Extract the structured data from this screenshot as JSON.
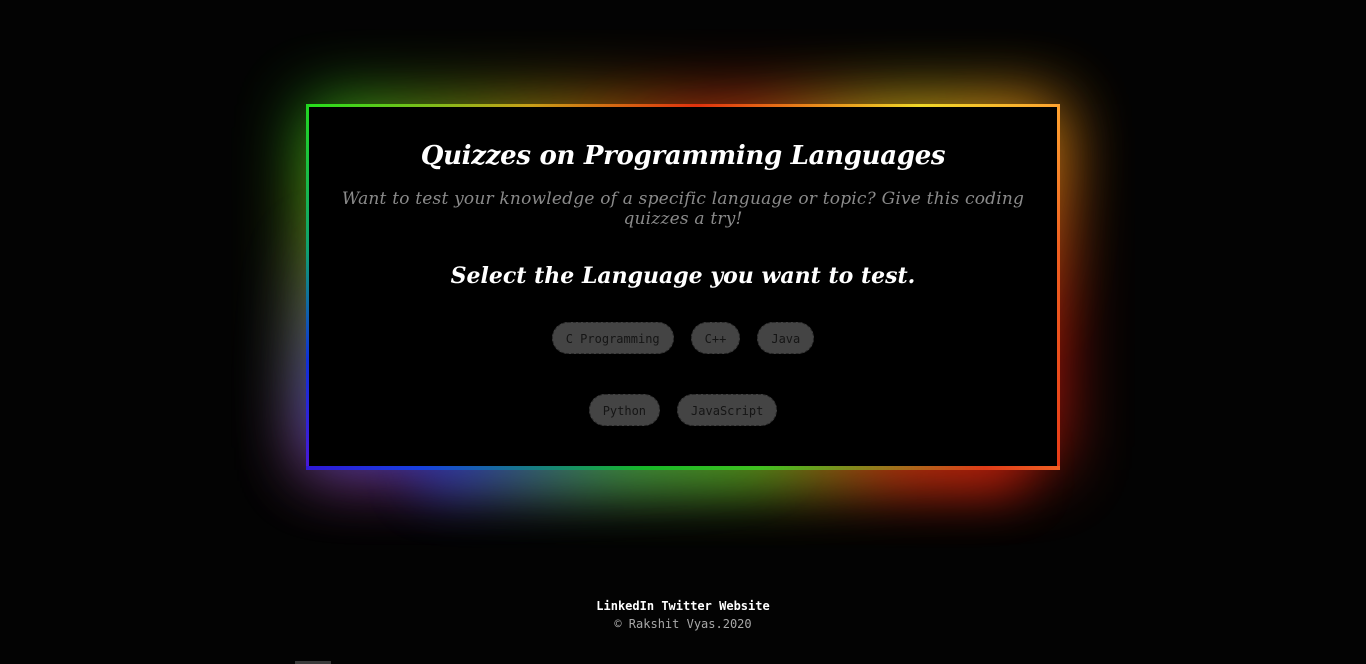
{
  "quiz": {
    "title": "Quizzes on Programming Languages",
    "subtitle": "Want to test your knowledge of a specific language or topic? Give this coding quizzes a try!",
    "select_heading": "Select the Language you want to test.",
    "languages": [
      "C Programming",
      "C++",
      "Java",
      "Python",
      "JavaScript"
    ]
  },
  "footer": {
    "links": [
      "LinkedIn",
      "Twitter",
      "Website"
    ],
    "copyright": "© Rakshit Vyas.2020"
  },
  "colors": {
    "background": "#030303",
    "button": "#444444",
    "frame_gradient": [
      "#22e01c",
      "#e0320e",
      "#f0d828",
      "#1840e0"
    ]
  }
}
